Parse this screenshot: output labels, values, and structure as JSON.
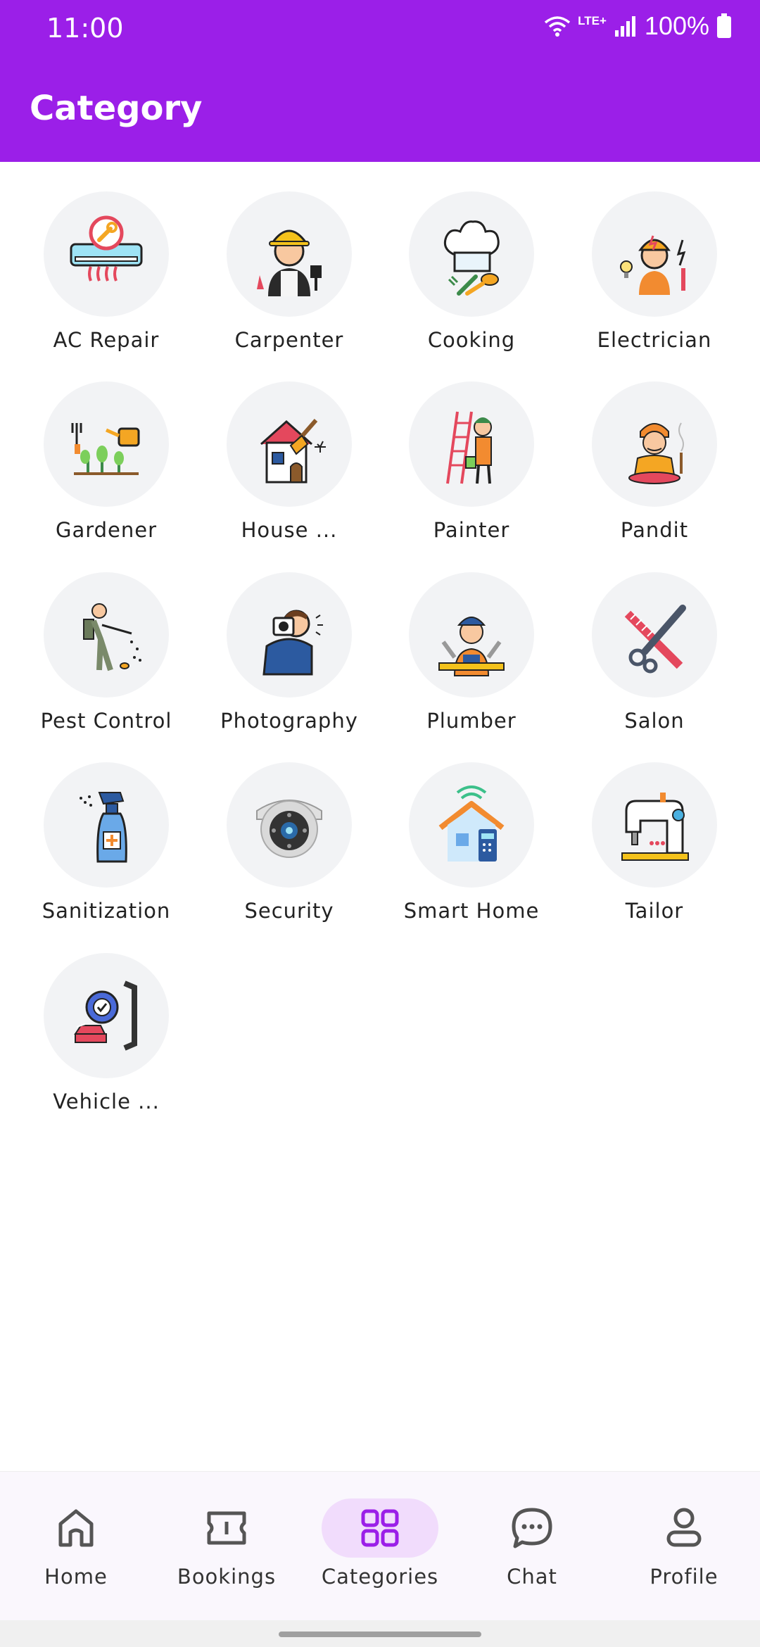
{
  "status_bar": {
    "time": "11:00",
    "network": "LTE+",
    "battery": "100%"
  },
  "header": {
    "title": "Category"
  },
  "categories": [
    {
      "label": "AC Repair",
      "icon": "ac-repair-icon"
    },
    {
      "label": "Carpenter",
      "icon": "carpenter-icon"
    },
    {
      "label": "Cooking",
      "icon": "chef-hat-icon"
    },
    {
      "label": "Electrician",
      "icon": "electrician-icon"
    },
    {
      "label": "Gardener",
      "icon": "gardener-icon"
    },
    {
      "label": "House ...",
      "icon": "house-cleaning-icon"
    },
    {
      "label": "Painter",
      "icon": "painter-icon"
    },
    {
      "label": "Pandit",
      "icon": "pandit-icon"
    },
    {
      "label": "Pest Control",
      "icon": "pest-control-icon"
    },
    {
      "label": "Photography",
      "icon": "photographer-icon"
    },
    {
      "label": "Plumber",
      "icon": "plumber-icon"
    },
    {
      "label": "Salon",
      "icon": "salon-icon"
    },
    {
      "label": "Sanitization",
      "icon": "spray-bottle-icon"
    },
    {
      "label": "Security",
      "icon": "security-camera-icon"
    },
    {
      "label": "Smart Home",
      "icon": "smart-home-icon"
    },
    {
      "label": "Tailor",
      "icon": "sewing-machine-icon"
    },
    {
      "label": "Vehicle ...",
      "icon": "vehicle-service-icon"
    }
  ],
  "bottom_nav": {
    "items": [
      {
        "label": "Home",
        "icon": "home-icon"
      },
      {
        "label": "Bookings",
        "icon": "ticket-icon"
      },
      {
        "label": "Categories",
        "icon": "grid-icon",
        "active": true
      },
      {
        "label": "Chat",
        "icon": "chat-bubble-icon"
      },
      {
        "label": "Profile",
        "icon": "person-icon"
      }
    ]
  },
  "colors": {
    "brand": "#9b1fe8",
    "active_nav_bg": "#f1dcfc",
    "circle_bg": "#f2f3f5"
  }
}
